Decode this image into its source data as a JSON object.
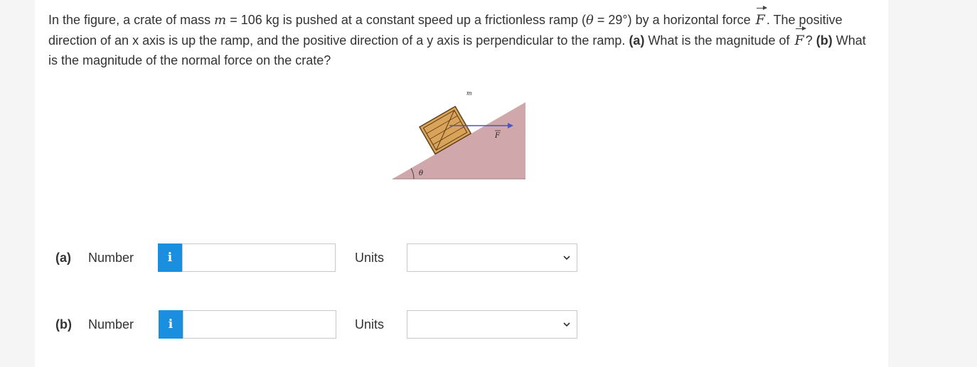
{
  "question": {
    "t1": "In the figure, a crate of mass ",
    "m_sym": "m",
    "t2": " = 106 kg is pushed at a constant speed up a frictionless ramp (",
    "theta_sym": "θ",
    "t3": " = 29°) by a horizontal force ",
    "F_sym": "F",
    "t4": ". The positive direction of an x axis is up the ramp, and the positive direction of a y axis is perpendicular to the ramp. ",
    "a_tag": "(a)",
    "t5": " What is the magnitude of ",
    "F_sym2": "F",
    "t6": "? ",
    "b_tag": "(b)",
    "t7": " What is the magnitude of the normal force on the crate?"
  },
  "figure": {
    "mass_label": "m",
    "force_label": "F",
    "angle_label": "θ",
    "ramp_color": "#d0a8ab",
    "crate_color": "#d9a45a",
    "force_color": "#4a55c8"
  },
  "parts": [
    {
      "label": "(a)",
      "number_label": "Number",
      "info_icon": "i",
      "value": "",
      "units_label": "Units",
      "units_value": ""
    },
    {
      "label": "(b)",
      "number_label": "Number",
      "info_icon": "i",
      "value": "",
      "units_label": "Units",
      "units_value": ""
    }
  ]
}
